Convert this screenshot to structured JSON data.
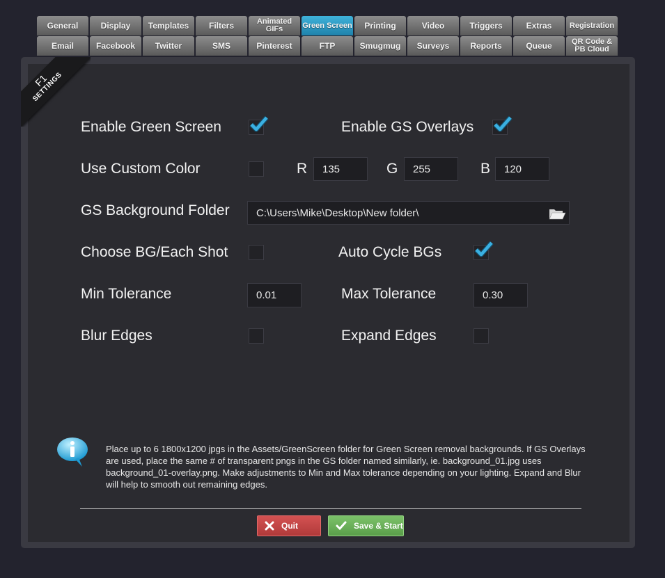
{
  "tabs_row1": [
    "General",
    "Display",
    "Templates",
    "Filters",
    "Animated GIFs",
    "Green Screen",
    "Printing",
    "Video",
    "Triggers",
    "Extras",
    "Registration"
  ],
  "tabs_row2": [
    "Email",
    "Facebook",
    "Twitter",
    "SMS",
    "Pinterest",
    "FTP",
    "Smugmug",
    "Surveys",
    "Reports",
    "Queue",
    "QR Code & PB Cloud"
  ],
  "active_tab": "Green Screen",
  "ribbon": {
    "key": "F1",
    "text": "SETTINGS"
  },
  "fields": {
    "enable_green_screen": {
      "label": "Enable Green Screen",
      "checked": true
    },
    "enable_gs_overlays": {
      "label": "Enable GS Overlays",
      "checked": true
    },
    "use_custom_color": {
      "label": "Use Custom Color",
      "checked": false
    },
    "r": {
      "label": "R",
      "value": "135"
    },
    "g": {
      "label": "G",
      "value": "255"
    },
    "b": {
      "label": "B",
      "value": "120"
    },
    "gs_background_folder": {
      "label": "GS Background Folder",
      "value": "C:\\Users\\Mike\\Desktop\\New folder\\"
    },
    "choose_bg_each_shot": {
      "label": "Choose BG/Each Shot",
      "checked": false
    },
    "auto_cycle_bgs": {
      "label": "Auto Cycle BGs",
      "checked": true
    },
    "min_tolerance": {
      "label": "Min Tolerance",
      "value": "0.01"
    },
    "max_tolerance": {
      "label": "Max Tolerance",
      "value": "0.30"
    },
    "blur_edges": {
      "label": "Blur Edges",
      "checked": false
    },
    "expand_edges": {
      "label": "Expand Edges",
      "checked": false
    }
  },
  "info_text": "Place up to 6 1800x1200 jpgs in the Assets/GreenScreen folder for Green Screen removal backgrounds.   If GS Overlays are used, place the same  # of transparent pngs in the GS folder named similarly, ie. background_01.jpg uses background_01-overlay.png.  Make adjustments to Min and Max tolerance depending on your lighting. Expand and Blur will help to smooth out remaining edges.",
  "buttons": {
    "quit": "Quit",
    "save": "Save & Start"
  },
  "colors": {
    "active_tab": "#2c9ac4",
    "quit": "#c44545",
    "save": "#6db35b",
    "check": "#3ab0e2"
  }
}
